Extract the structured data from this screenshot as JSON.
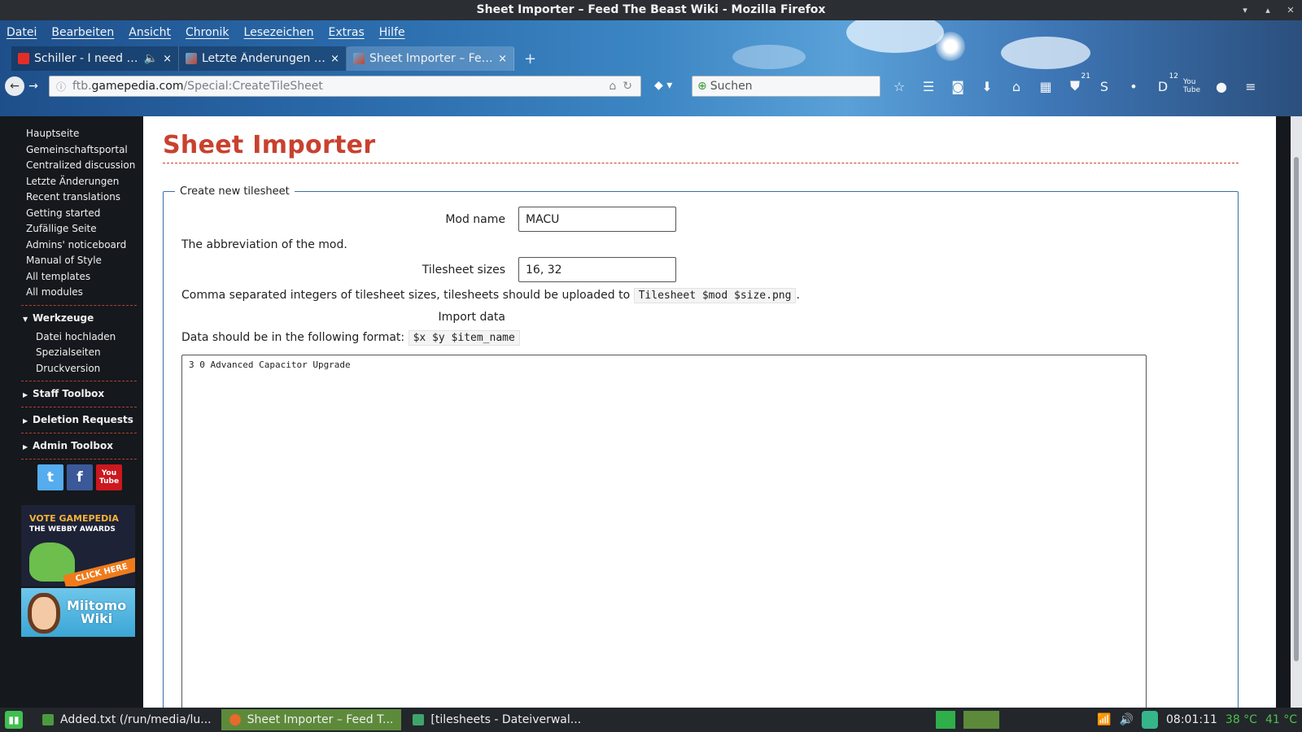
{
  "window": {
    "title": "Sheet Importer – Feed The Beast Wiki - Mozilla Firefox",
    "controls": [
      "▾",
      "▴",
      "✕"
    ]
  },
  "menubar": [
    "Datei",
    "Bearbeiten",
    "Ansicht",
    "Chronik",
    "Lesezeichen",
    "Extras",
    "Hilfe"
  ],
  "tabs": [
    {
      "label": "Schiller - I need y...",
      "icon": "youtube-icon",
      "audio": "🔈",
      "close": "×"
    },
    {
      "label": "Letzte Änderungen – ...",
      "icon": "gamepedia-icon",
      "close": "×"
    },
    {
      "label": "Sheet Importer – Fee...",
      "icon": "gamepedia-icon",
      "close": "×"
    }
  ],
  "newtab_label": "+",
  "nav": {
    "back": "←",
    "forward": "→",
    "url_prefix": "ftb.",
    "url_host": "gamepedia.com",
    "url_path": "/Special:CreateTileSheet",
    "search_placeholder": "Suchen",
    "badges": {
      "ublock": "21",
      "ext": "12"
    }
  },
  "sidebar": {
    "links": [
      "Hauptseite",
      "Gemeinschaftsportal",
      "Centralized discussion",
      "Letzte Änderungen",
      "Recent translations",
      "Getting started",
      "Zufällige Seite",
      "Admins' noticeboard",
      "Manual of Style",
      "All templates",
      "All modules"
    ],
    "tools_heading": "Werkzeuge",
    "tools": [
      "Datei hochladen",
      "Spezialseiten",
      "Druckversion"
    ],
    "collapsed": [
      "Staff Toolbox",
      "Deletion Requests",
      "Admin Toolbox"
    ],
    "social": [
      {
        "name": "twitter",
        "glyph": "t",
        "color": "#55acee"
      },
      {
        "name": "facebook",
        "glyph": "f",
        "color": "#3b5998"
      },
      {
        "name": "youtube",
        "glyph": "You Tube",
        "color": "#cc181e"
      }
    ],
    "banner1": {
      "line1": "VOTE GAMEPEDIA",
      "line2": "THE WEBBY AWARDS",
      "cta": "CLICK HERE"
    },
    "banner2": {
      "line1": "Miitomo",
      "line2": "Wiki"
    }
  },
  "main": {
    "title": "Sheet Importer",
    "legend": "Create new tilesheet",
    "mod_name_label": "Mod name",
    "mod_name_value": "MACU",
    "mod_name_help": "The abbreviation of the mod.",
    "sizes_label": "Tilesheet sizes",
    "sizes_value": "16, 32",
    "sizes_help_prefix": "Comma separated integers of tilesheet sizes, tilesheets should be uploaded to",
    "sizes_help_code": "Tilesheet $mod $size.png",
    "sizes_help_suffix": ".",
    "import_label": "Import data",
    "import_help_prefix": "Data should be in the following format:",
    "import_help_code": "$x $y $item_name",
    "import_value": "3 0 Advanced Capacitor Upgrade"
  },
  "taskbar": {
    "tasks": [
      {
        "label": "Added.txt (/run/media/lu...",
        "color": "#4c9a3e"
      },
      {
        "label": "Sheet Importer – Feed T...",
        "color": "#e66a2c"
      },
      {
        "label": "[tilesheets - Dateiverwal...",
        "color": "#3fa46a"
      }
    ],
    "time": "08:01:11",
    "temp1": "38 °C",
    "temp2": "41 °C"
  },
  "colors": {
    "accent": "#c9412e",
    "fieldset_border": "#3a6ea5"
  }
}
